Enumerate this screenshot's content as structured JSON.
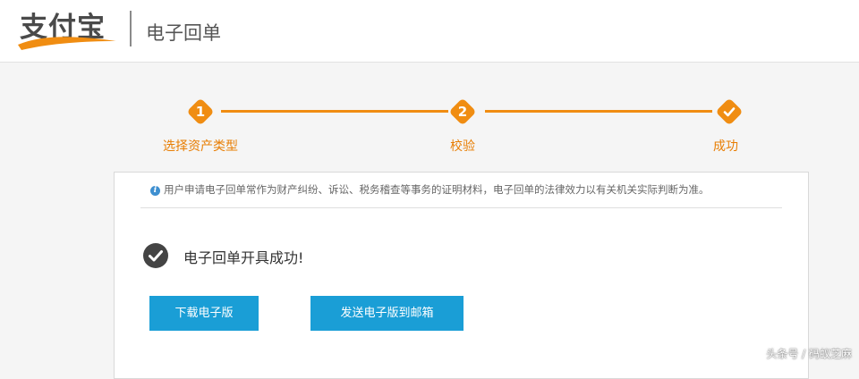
{
  "header": {
    "logo_text": "支付宝",
    "title": "电子回单"
  },
  "steps": [
    {
      "number": "1",
      "label": "选择资产类型",
      "status": "done"
    },
    {
      "number": "2",
      "label": "校验",
      "status": "done"
    },
    {
      "number": "",
      "label": "成功",
      "status": "current"
    }
  ],
  "panel": {
    "notice": "用户申请电子回单常作为财产纠纷、诉讼、税务稽查等事务的证明材料，电子回单的法律效力以有关机关实际判断为准。",
    "success_message": "电子回单开具成功!",
    "download_label": "下载电子版",
    "email_label": "发送电子版到邮箱"
  },
  "watermark": "头条号 / 码蚁芝麻",
  "colors": {
    "accent": "#f08d12",
    "step_label": "#e87e04",
    "button": "#1a9ed6"
  }
}
